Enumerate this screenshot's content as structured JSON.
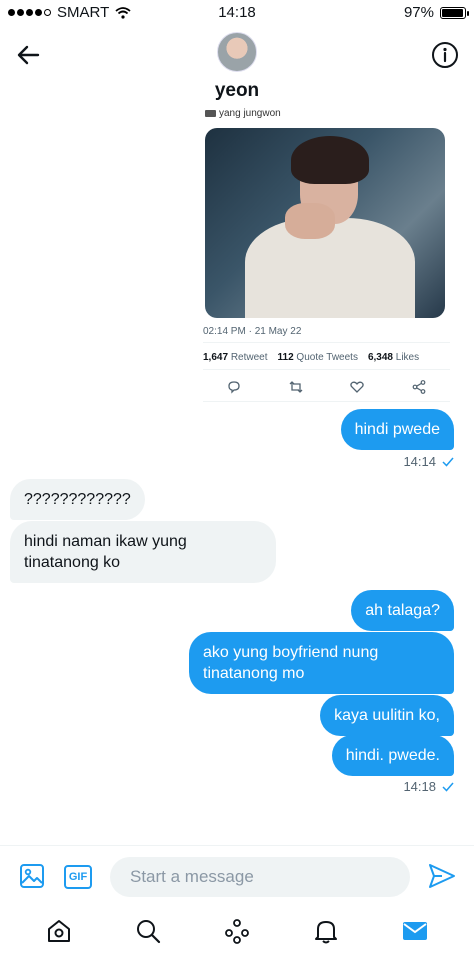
{
  "status_bar": {
    "carrier": "SMART",
    "time": "14:18",
    "battery": "97%",
    "battery_level": 0.97
  },
  "header": {
    "username": "yeon"
  },
  "tweet": {
    "source_label": "yang jungwon",
    "timestamp": "02:14 PM · 21 May 22",
    "retweets_count": "1,647",
    "retweets_label": "Retweet",
    "quotes_count": "112",
    "quotes_label": "Quote Tweets",
    "likes_count": "6,348",
    "likes_label": "Likes"
  },
  "messages": [
    {
      "id": "m1",
      "direction": "out",
      "text": "hindi pwede"
    },
    {
      "id": "m2",
      "direction": "in",
      "text": "????????????"
    },
    {
      "id": "m3",
      "direction": "in",
      "text": "hindi naman ikaw yung tinatanong ko"
    },
    {
      "id": "m4",
      "direction": "out",
      "text": "ah talaga?"
    },
    {
      "id": "m5",
      "direction": "out",
      "text": "ako yung boyfriend nung tinatanong mo"
    },
    {
      "id": "m6",
      "direction": "out",
      "text": "kaya uulitin ko,"
    },
    {
      "id": "m7",
      "direction": "out",
      "text": "hindi. pwede."
    }
  ],
  "timestamps": {
    "first": "14:14",
    "last": "14:18"
  },
  "composer": {
    "placeholder": "Start a message",
    "gif_label": "GIF"
  },
  "tabbar": {
    "items": [
      "home-icon",
      "search-icon",
      "spaces-icon",
      "notifications-icon",
      "messages-icon"
    ]
  },
  "colors": {
    "accent": "#1d9bf0",
    "incoming_bubble": "#eff3f4",
    "muted_text": "#536471"
  }
}
